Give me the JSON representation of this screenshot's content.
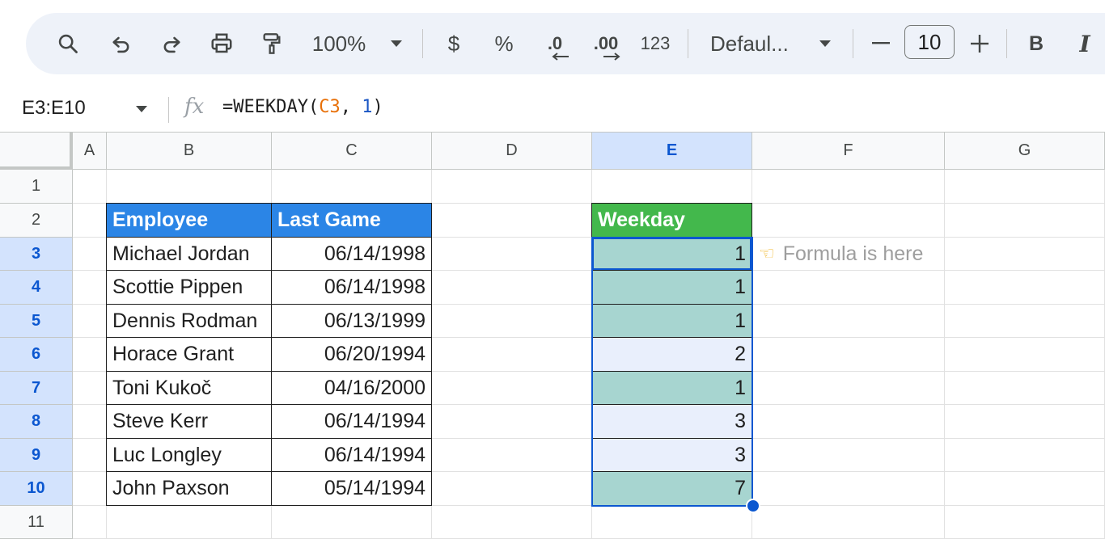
{
  "toolbar": {
    "zoom": "100%",
    "currency_label": "$",
    "percent_label": "%",
    "decrease_decimal_label": ".0",
    "increase_decimal_label": ".00",
    "number_format_label": "123",
    "font_name": "Defaul...",
    "font_size": "10",
    "bold_label": "B",
    "italic_label": "I"
  },
  "formula_bar": {
    "name_box": "E3:E10",
    "fx_label": "fx",
    "formula_prefix": "=WEEKDAY(",
    "formula_ref": "C3",
    "formula_sep": ", ",
    "formula_arg": "1",
    "formula_suffix": ")"
  },
  "columns": [
    "A",
    "B",
    "C",
    "D",
    "E",
    "F",
    "G"
  ],
  "rows": [
    "1",
    "2",
    "3",
    "4",
    "5",
    "6",
    "7",
    "8",
    "9",
    "10",
    "11"
  ],
  "table": {
    "headers": {
      "employee": "Employee",
      "last_game": "Last Game",
      "weekday": "Weekday"
    },
    "rows": [
      {
        "employee": "Michael Jordan",
        "last_game": "06/14/1998",
        "weekday": "1"
      },
      {
        "employee": "Scottie Pippen",
        "last_game": "06/14/1998",
        "weekday": "1"
      },
      {
        "employee": "Dennis Rodman",
        "last_game": "06/13/1999",
        "weekday": "1"
      },
      {
        "employee": "Horace Grant",
        "last_game": "06/20/1994",
        "weekday": "2"
      },
      {
        "employee": "Toni Kukoč",
        "last_game": "04/16/2000",
        "weekday": "1"
      },
      {
        "employee": "Steve Kerr",
        "last_game": "06/14/1994",
        "weekday": "3"
      },
      {
        "employee": "Luc Longley",
        "last_game": "06/14/1994",
        "weekday": "3"
      },
      {
        "employee": "John Paxson",
        "last_game": "05/14/1994",
        "weekday": "7"
      }
    ]
  },
  "note": {
    "icon": "pointing-hand-icon",
    "text": "Formula is here"
  },
  "colors": {
    "header_blue": "#2b85e6",
    "header_green": "#43b84c",
    "selection": "#0b57d0",
    "weekday_fill": "#a7d5d0"
  }
}
